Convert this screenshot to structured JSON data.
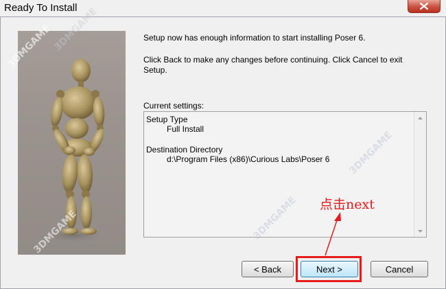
{
  "window": {
    "title": "Ready To Install",
    "close_icon": "close-icon"
  },
  "intro": {
    "line1": "Setup now has enough information to start installing Poser 6.",
    "line2a": "Click Back to make any changes before continuing. Click Cancel to exit",
    "line2b": "Setup."
  },
  "settings": {
    "label": "Current settings:",
    "setup_type_heading": "Setup Type",
    "setup_type_value": "Full Install",
    "dest_heading": "Destination Directory",
    "dest_value": "d:\\Program Files (x86)\\Curious Labs\\Poser 6"
  },
  "annotation": {
    "text": "点击next",
    "color": "#e8191b"
  },
  "buttons": {
    "back": "< Back",
    "next": "Next >",
    "cancel": "Cancel"
  },
  "watermarks": [
    "3DMGAME",
    "3DMGAME",
    "3DMGAME",
    "3DMGAME",
    "3DMGAME"
  ]
}
